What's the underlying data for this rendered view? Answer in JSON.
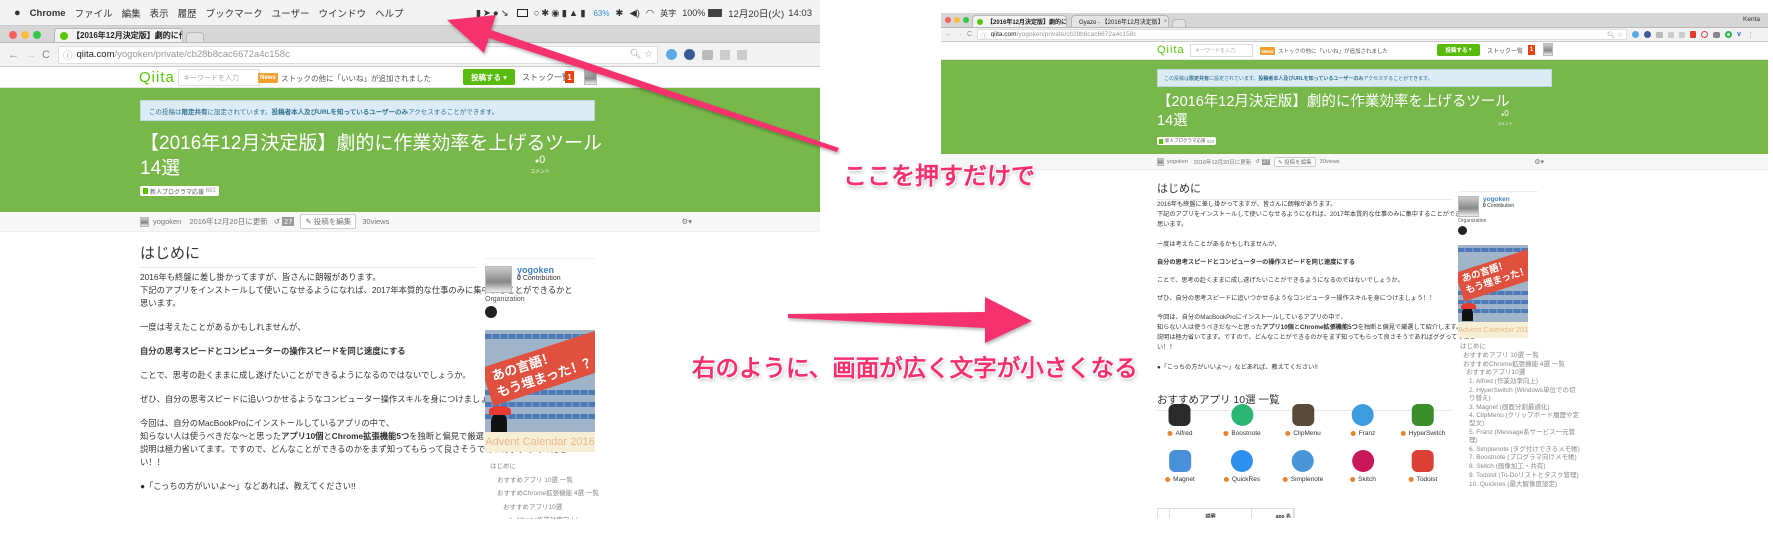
{
  "menubar": {
    "app": "Chrome",
    "items": [
      "ファイル",
      "編集",
      "表示",
      "履歴",
      "ブックマーク",
      "ユーザー",
      "ウインドウ",
      "ヘルプ"
    ],
    "battery_ring": "63%",
    "input_mode": "英字",
    "battery": "100%",
    "date": "12月20日(火)",
    "time": "14:03"
  },
  "browser": {
    "tab_title": "【2016年12月決定版】劇的に作",
    "tab2_title": "Gyazo - 【2016年12月決定版】",
    "close": "×",
    "url_host": "qiita.com",
    "url_path": "/yogoken/private/cb28b8cac6672a4c158c",
    "profile": "Kenta"
  },
  "qiita": {
    "logo": "Qiita",
    "search_placeholder": "キーワードを入力",
    "news_badge": "News",
    "news_text": "ストックの他に「いいね」が追加されました",
    "post_button": "投稿する",
    "stock_list": "ストック一覧",
    "notif_count": "1"
  },
  "article": {
    "notice_pre": "この投稿は ",
    "notice_bold1": "限定共有",
    "notice_mid": "に設定されています。 ",
    "notice_bold2": "投稿者本人及びURLを知っているユーザーのみ",
    "notice_post": "アクセスすることができます。",
    "title_line1": "【2016年12月決定版】劇的に作業効率を上げるツール",
    "title_line2": "14選",
    "comment_count": "0",
    "comment_label": "コメント",
    "tag": "新人プログラマ応援",
    "tag_count": "683",
    "author": "yogoken",
    "updated": "2016年12月20日に更新",
    "revisions": "27",
    "edit_button": "投稿を編集",
    "views": "30views",
    "heading": "はじめに",
    "lines": {
      "l1": "2016年も終盤に差し掛かってますが、皆さんに朗報があります。",
      "l2": "下記のアプリをインストールして使いこなせるようになれば、2017年本質的な仕事のみに集中することができるかと",
      "l3": "思います。",
      "l4": "一度は考えたことがあるかもしれませんが、",
      "l5": "自分の思考スピードとコンピューターの操作スピードを同じ速度にする",
      "l6": "ことで、思考の赴くままに成し遂げたいことができるようになるのではないでしょうか。",
      "l7": "ぜひ、自分の思考スピードに追いつかせるようなコンピューター操作スキルを身につけましょう！！",
      "l8": "今回は、自分のMacBookProにインストールしているアプリの中で、",
      "l9a": "知らない人は使うべきだな〜と思った",
      "l9b": "アプリ10個",
      "l9c": "と",
      "l9d": "Chrome拡張機能5つ",
      "l9e": "を独断と偏見で厳選して紹介します。",
      "l10": "説明は極力省いてます。ですので、どんなことができるのかをまず知ってもらって良さそうであればググってくださ",
      "l11": "い！！",
      "l12": "●「こっちの方がいいよ〜」などあれば、教えてください!!"
    },
    "apps_heading": "おすすめアプリ 10選 一覧",
    "apps": [
      {
        "name": "Alfred",
        "color": "#2b2b2b"
      },
      {
        "name": "Boostnote",
        "color": "#2bb673"
      },
      {
        "name": "ClipMenu",
        "color": "#5b4a3a"
      },
      {
        "name": "Franz",
        "color": "#3d9be0"
      },
      {
        "name": "HyperSwitch",
        "color": "#3b8f2b"
      },
      {
        "name": "Magnet",
        "color": "#4a90d9"
      },
      {
        "name": "QuickRes",
        "color": "#2d8ff0"
      },
      {
        "name": "Simplenote",
        "color": "#4895d9"
      },
      {
        "name": "Skitch",
        "color": "#c9185a"
      },
      {
        "name": "Todoist",
        "color": "#db4035"
      }
    ],
    "table_headers": [
      "説明",
      "app 名"
    ]
  },
  "sidebar": {
    "user": "yogoken",
    "contribution_count": "0",
    "contribution_label": "Contribution",
    "organization": "Organization",
    "banner_line1": "あの言語！",
    "banner_line2": "もう埋まった！？",
    "banner_footer": "Advent Calendar 2016",
    "toc": [
      "はじめに",
      "おすすめアプリ 10選 一覧",
      "おすすめChrome拡張機能 4選 一覧",
      "おすすめアプリ10選",
      "1. Alfred (作業効率向上)",
      "2. HyperSwitch (Windows単位での切り替え)",
      "3. Magnet (画面分割最適化)",
      "4. ClipMenu (クリップボード履歴や定型文)",
      "5. Franz (Message系サービス一元管理)",
      "6. Simplenote (タグ付けできるメモ帳)",
      "7. Boostnote (プログラマ向けメモ帳)",
      "8. Skitch (画像加工・共有)",
      "9. Todoist (To-Doリストとタスク管理)",
      "10. Quickres (最大解像度設定)"
    ]
  },
  "annotations": {
    "press_here": "ここを押すだけで",
    "result": "右のように、画面が広く文字が小さくなる",
    "color": "#f5306e"
  }
}
